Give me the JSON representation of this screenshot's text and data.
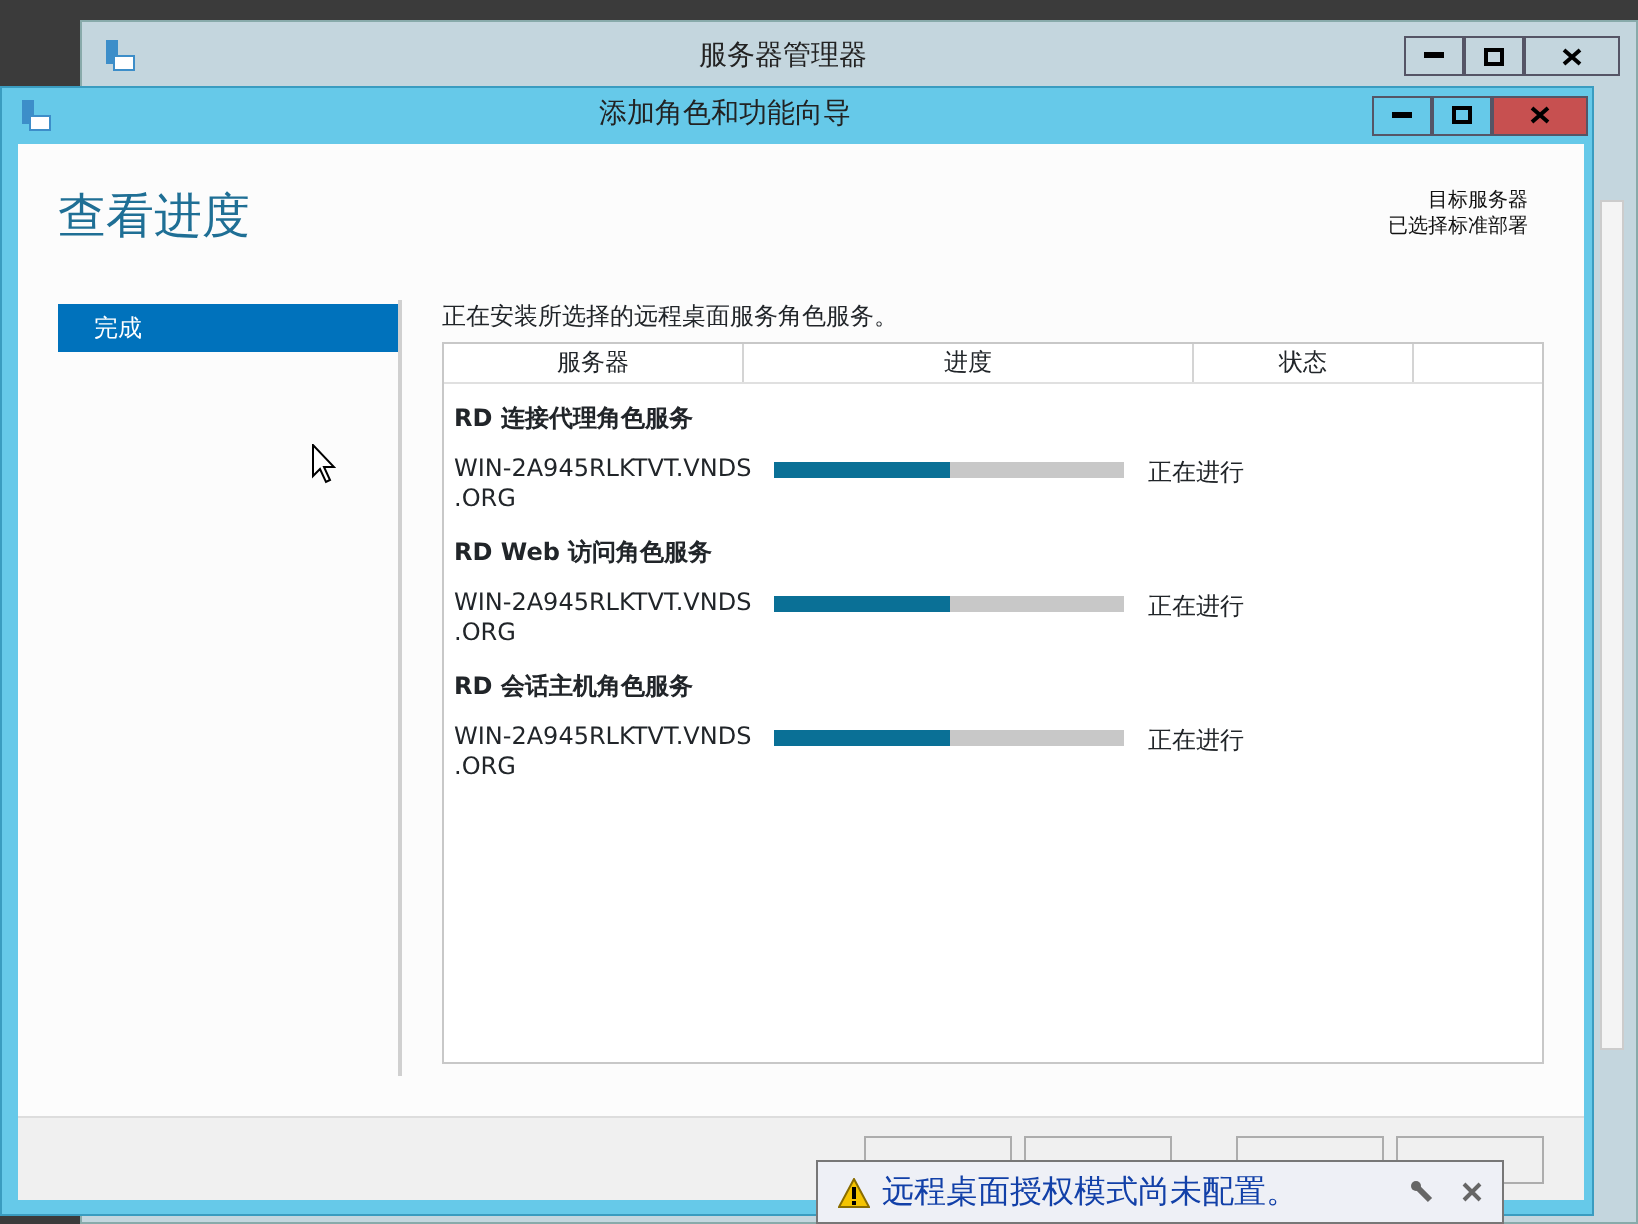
{
  "background_window": {
    "title": "服务器管理器"
  },
  "wizard": {
    "title": "添加角色和功能向导",
    "heading": "查看进度",
    "target_label": "目标服务器",
    "target_value": "已选择标准部署",
    "steps": [
      {
        "label": "完成",
        "selected": true
      }
    ],
    "description": "正在安装所选择的远程桌面服务角色服务。",
    "columns": [
      "服务器",
      "进度",
      "状态"
    ],
    "groups": [
      {
        "title": "RD 连接代理角色服务",
        "server_lines": [
          "WIN-2A945RLKTVT.VNDS",
          ".ORG"
        ],
        "level": 0.5,
        "status": "正在进行"
      },
      {
        "title": "RD Web 访问角色服务",
        "server_lines": [
          "WIN-2A945RLKTVT.VNDS",
          ".ORG"
        ],
        "level": 0.5,
        "status": "正在进行"
      },
      {
        "title": "RD 会话主机角色服务",
        "server_lines": [
          "WIN-2A945RLKTVT.VNDS",
          ".ORG"
        ],
        "level": 0.5,
        "status": "正在进行"
      }
    ]
  },
  "notification": {
    "text": "远程桌面授权模式尚未配置。"
  }
}
